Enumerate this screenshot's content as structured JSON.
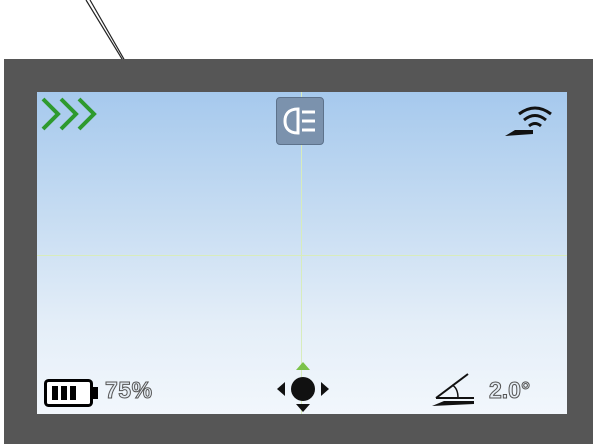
{
  "status_bar": {
    "battery_level": "75%",
    "tilt_angle": "2.0°"
  },
  "icons": {
    "speed": "triple-chevron-icon",
    "headlight": "headlight-icon",
    "signal": "signal-icon",
    "battery": "battery-icon",
    "navigation": "direction-pad-icon",
    "angle": "angle-icon"
  },
  "colors": {
    "bezel": "#565656",
    "screen_top": "#a6c9ed",
    "screen_bottom": "#f2f7fc",
    "crosshair": "#d8ecbc",
    "accent_green": "#2e9a2e",
    "nav_green": "#7cc24a",
    "headlight_button": "#7b92ad"
  }
}
